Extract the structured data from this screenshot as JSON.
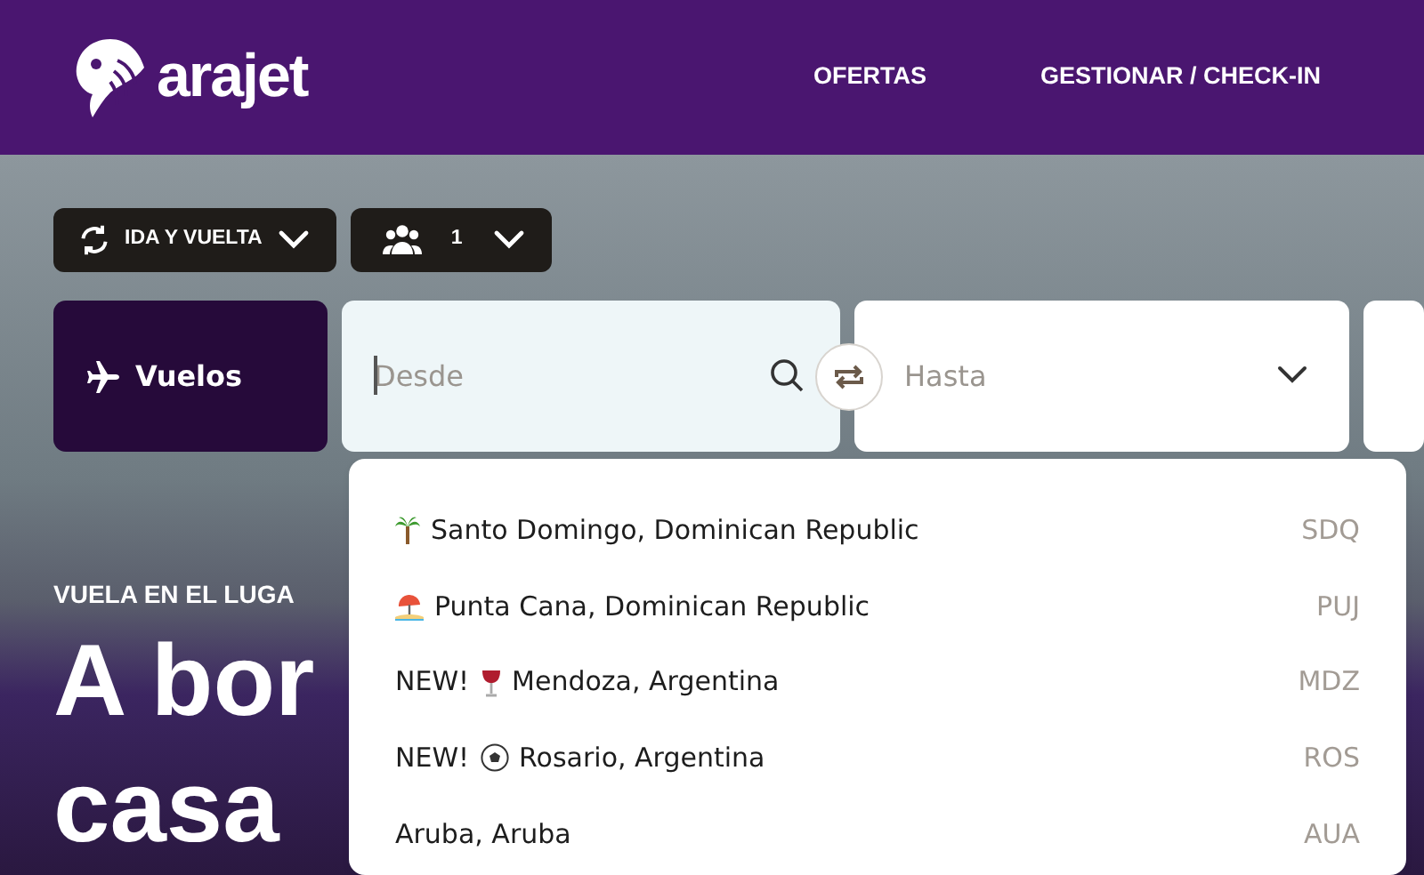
{
  "header": {
    "logo_text": "arajet",
    "nav": [
      {
        "label": "OFERTAS"
      },
      {
        "label": "GESTIONAR / CHECK-IN"
      }
    ]
  },
  "trip_options": {
    "trip_type": "IDA Y VUELTA",
    "passengers": "1"
  },
  "search": {
    "tab": "Vuelos",
    "from": {
      "placeholder": "Desde"
    },
    "to": {
      "placeholder": "Hasta"
    }
  },
  "dropdown": [
    {
      "kind": "palm",
      "name": "Santo Domingo, Dominican Republic",
      "code": "SDQ"
    },
    {
      "kind": "beach",
      "name": "Punta Cana, Dominican Republic",
      "code": "PUJ"
    },
    {
      "kind": "wine",
      "prefix": "NEW!",
      "name": "Mendoza, Argentina",
      "code": "MDZ"
    },
    {
      "kind": "ball",
      "prefix": "NEW!",
      "name": "Rosario, Argentina",
      "code": "ROS"
    },
    {
      "kind": "none",
      "name": "Aruba, Aruba",
      "code": "AUA"
    }
  ],
  "hero": {
    "eyebrow": "VUELA EN EL LUGA",
    "headline": [
      "A bor",
      "casa"
    ]
  }
}
